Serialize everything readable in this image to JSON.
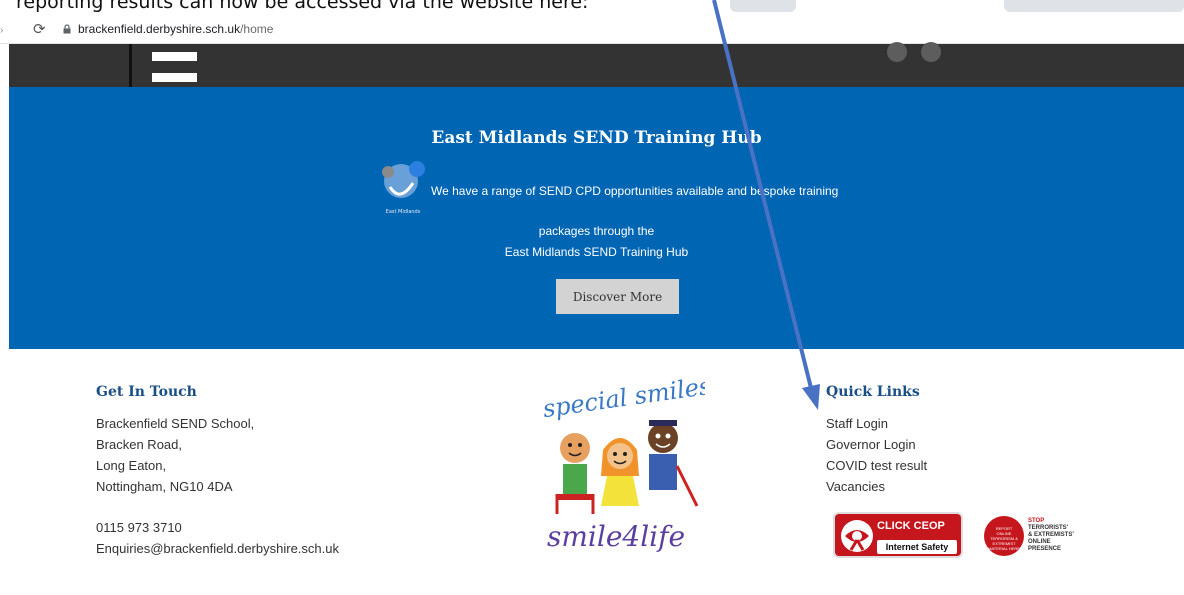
{
  "partial_caption": "reporting results can now be accessed via the website here:",
  "browser": {
    "url_domain": "brackenfield.derbyshire.sch.uk",
    "url_path": "/home"
  },
  "hero": {
    "title": "East Midlands SEND Training Hub",
    "line1": "We have a range of SEND CPD opportunities available and bespoke training",
    "line2": "packages through the",
    "line3": "East Midlands SEND Training Hub",
    "button_label": "Discover More",
    "logo_caption": "East Midlands"
  },
  "footer": {
    "get_in_touch": {
      "heading": "Get In Touch",
      "address": [
        "Brackenfield SEND School,",
        "Bracken Road,",
        "Long Eaton,",
        "Nottingham, NG10 4DA"
      ],
      "phone": "0115 973 3710",
      "email": "Enquiries@brackenfield.derbyshire.sch.uk"
    },
    "logo": {
      "top_text": "special smiles",
      "bottom_text": "smile4life"
    },
    "quick_links": {
      "heading": "Quick Links",
      "links": [
        "Staff Login",
        "Governor Login",
        "COVID test result",
        "Vacancies"
      ]
    },
    "badges": {
      "ceop_top": "CLICK CEOP",
      "ceop_bottom": "Internet Safety",
      "stop_small": "REPORT ONLINE TERRORISM & EXTREMIST MATERIAL HERE",
      "stop_line1": "STOP",
      "stop_line2": "TERRORISTS'",
      "stop_line3": "& EXTREMISTS'",
      "stop_line4": "ONLINE",
      "stop_line5": "PRESENCE"
    }
  },
  "colors": {
    "hero_blue": "#0065b3",
    "header_dark": "#333333",
    "heading_blue": "#1a4f86",
    "arrow_blue": "#4a72c4"
  }
}
